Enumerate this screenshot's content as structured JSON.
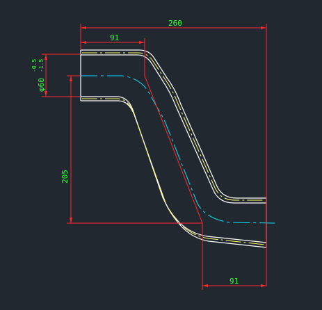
{
  "drawing": {
    "dimensions": {
      "overall_length": "260",
      "top_straight": "91",
      "bottom_straight": "91",
      "offset_height": "205",
      "diameter_main": "φ60",
      "tol_upper": "-0.5",
      "tol_lower": "-1.5"
    },
    "colors": {
      "background": "#212830",
      "pipe_outline": "#ffffff",
      "wall_line": "#ffff66",
      "centerline": "#00e5ff",
      "dimension_line": "#ff2a2a",
      "dimension_text": "#33ff33"
    }
  }
}
